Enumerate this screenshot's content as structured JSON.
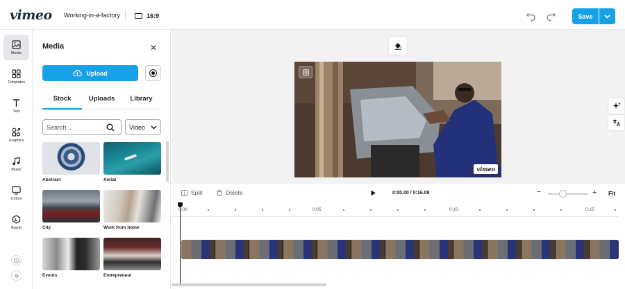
{
  "header": {
    "logo": "vimeo",
    "project_title": "Working-in-a-factory",
    "aspect_ratio": "16:9",
    "save_label": "Save",
    "accent_color": "#17a2e8"
  },
  "rail": {
    "items": [
      {
        "label": "Media",
        "icon": "image-icon"
      },
      {
        "label": "Templates",
        "icon": "grid-icon"
      },
      {
        "label": "Text",
        "icon": "text-icon"
      },
      {
        "label": "Graphics",
        "icon": "shapes-icon"
      },
      {
        "label": "Music",
        "icon": "music-icon"
      },
      {
        "label": "Colors",
        "icon": "monitor-icon"
      },
      {
        "label": "Brand",
        "icon": "brand-icon"
      }
    ]
  },
  "panel": {
    "title": "Media",
    "upload_label": "Upload",
    "tabs": [
      "Stock",
      "Uploads",
      "Library"
    ],
    "active_tab": "Stock",
    "search_placeholder": "Search...",
    "type_select": "Video",
    "tiles": [
      {
        "label": "Abstract"
      },
      {
        "label": "Aerial"
      },
      {
        "label": "City"
      },
      {
        "label": "Work from home"
      },
      {
        "label": "Events"
      },
      {
        "label": "Entrepreneur"
      }
    ]
  },
  "preview": {
    "watermark": "vimeo"
  },
  "timeline": {
    "split_label": "Split",
    "delete_label": "Delete",
    "current_time": "0:00.00",
    "duration": "0:16.08",
    "fit_label": "Fit",
    "ruler_labels": [
      "0:00",
      "0:05",
      "0:10",
      "0:15"
    ]
  }
}
